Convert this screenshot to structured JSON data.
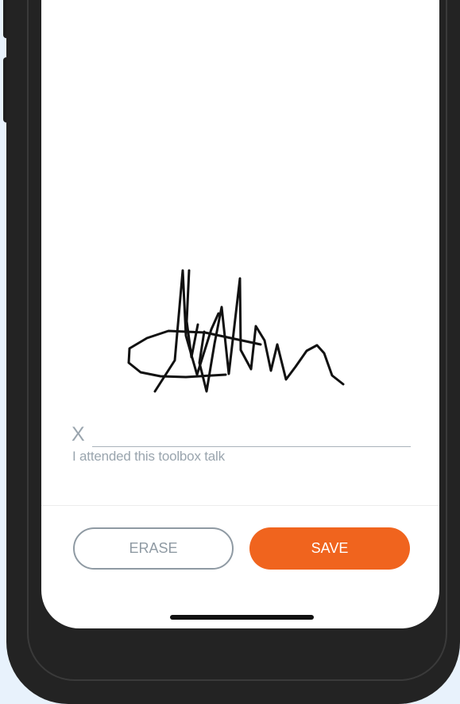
{
  "signature_pad": {
    "x_mark": "X",
    "caption": "I attended this toolbox talk"
  },
  "actions": {
    "erase_label": "ERASE",
    "save_label": "SAVE"
  },
  "colors": {
    "accent": "#f0641e",
    "muted": "#9aa5ae",
    "background": "#e8f2fc"
  }
}
